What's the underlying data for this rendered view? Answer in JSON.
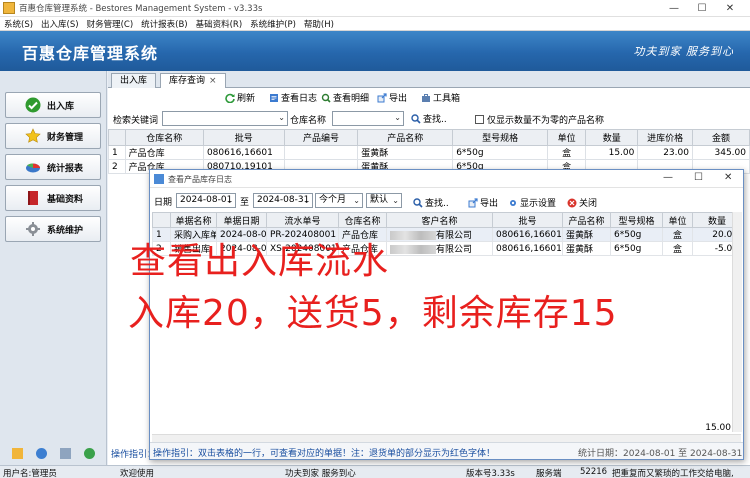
{
  "window": {
    "title": "百惠仓库管理系统 - Bestores Management System - v3.33s",
    "controls": [
      "—",
      "☐",
      "✕"
    ]
  },
  "menu": [
    "系统(S)",
    "出入库(S)",
    "财务管理(C)",
    "统计报表(B)",
    "基础资料(R)",
    "系统维护(P)",
    "帮助(H)"
  ],
  "banner": {
    "app_name": "百惠仓库管理系统",
    "slogan": "功夫到家 服务到心"
  },
  "sidebar": {
    "items": [
      {
        "label": "出入库",
        "icon": "checkmark-icon"
      },
      {
        "label": "财务管理",
        "icon": "star-icon"
      },
      {
        "label": "统计报表",
        "icon": "pie-chart-icon"
      },
      {
        "label": "基础资料",
        "icon": "book-icon"
      },
      {
        "label": "系统维护",
        "icon": "gear-icon"
      }
    ]
  },
  "tabs": [
    {
      "label": "出入库"
    },
    {
      "label": "库存查询",
      "close": "×"
    }
  ],
  "toolbar": {
    "refresh": "刷新",
    "view_log": "查看日志",
    "view_detail": "查看明细",
    "export": "导出",
    "toolbox": "工具箱"
  },
  "filter": {
    "keyword_label": "检索关键词",
    "warehouse_label": "仓库名称",
    "search": "查找..",
    "nonzero_label": "仅显示数量不为零的产品名称"
  },
  "stock_grid": {
    "columns": [
      "",
      "仓库名称",
      "批号",
      "产品编号",
      "产品名称",
      "型号规格",
      "单位",
      "数量",
      "进库价格",
      "金额"
    ],
    "rows": [
      [
        "1",
        "产品仓库",
        "080616,16601",
        "",
        "蛋黄酥",
        "6*50g",
        "盒",
        "15.00",
        "23.00",
        "345.00"
      ],
      [
        "2",
        "产品仓库",
        "080710,19101",
        "",
        "蛋黄酥",
        "6*50g",
        "盒",
        "",
        "",
        ""
      ]
    ]
  },
  "guide": "操作指引：双击表格的一行，可查看对应的单据！注：退货单的部分显示为红色字体！",
  "statusbar": {
    "user": "用户名:管理员",
    "status": "欢迎使用",
    "slogan": "功夫到家 服务到心",
    "version": "版本号3.33s",
    "server_label": "服务端",
    "server_port": "52216",
    "ticker": "把重复而又繁琐的工作交给电脑,"
  },
  "dialog": {
    "title": "查看产品库存日志",
    "controls": [
      "—",
      "☐",
      "✕"
    ],
    "date_label": "日期",
    "date_from": "2024-08-01",
    "to_label": "至",
    "date_to": "2024-08-31",
    "period": "今个月",
    "sort": "默认",
    "search": "查找..",
    "export": "导出",
    "display_settings": "显示设置",
    "close": "关闭",
    "columns": [
      "",
      "单据名称",
      "单据日期",
      "流水单号",
      "仓库名称",
      "客户名称",
      "批号",
      "产品名称",
      "型号规格",
      "单位",
      "数量"
    ],
    "rows": [
      [
        "1",
        "采购入库单",
        "2024-08-06",
        "PR-202408001",
        "产品仓库",
        "有限公司",
        "080616,16601",
        "蛋黄酥",
        "6*50g",
        "盒",
        "20.00"
      ],
      [
        "2",
        "销售出库",
        "2024-08-07",
        "XS-202408001",
        "产品仓库",
        "有限公司",
        "080616,16601",
        "蛋黄酥",
        "6*50g",
        "盒",
        "-5.00"
      ]
    ],
    "sum": "15.00",
    "guide": "操作指引：双击表格的一行，可查看对应的单据！注：退货单的部分显示为红色字体！",
    "stat_date": "统计日期：2024-08-01 至 2024-08-31"
  },
  "annotation": {
    "line1": "查看出入库流水",
    "line2": "入库20，送货5，剩余库存15"
  },
  "colors": {
    "banner": "#2667ad",
    "annotation": "#e8201e"
  }
}
